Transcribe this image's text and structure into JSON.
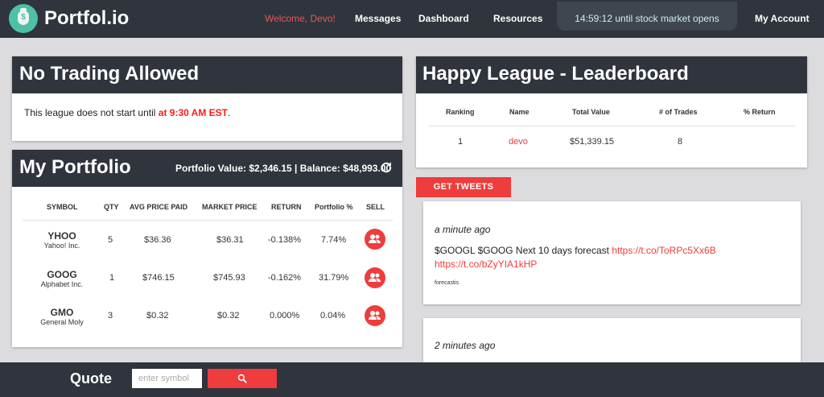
{
  "nav": {
    "brand": "Portfol.io",
    "logo_icon": "money-bag-icon",
    "welcome": "Welcome, Devo!",
    "messages": "Messages",
    "dashboard": "Dashboard",
    "resources": "Resources",
    "timer": "14:59:12 until stock market opens",
    "account": "My Account"
  },
  "notice": {
    "title": "No Trading Allowed",
    "text_prefix": "This league does not start until ",
    "time": "at 9:30 AM EST",
    "text_suffix": "."
  },
  "portfolio": {
    "title": "My Portfolio",
    "summary": "Portfolio Value: $2,346.15 | Balance: $48,993.00",
    "refresh_icon": "refresh-icon",
    "columns": [
      "SYMBOL",
      "QTY",
      "AVG PRICE PAID",
      "MARKET PRICE",
      "RETURN",
      "Portfolio %",
      "SELL"
    ],
    "rows": [
      {
        "symbol": "YHOO",
        "name": "Yahoo! Inc.",
        "qty": "5",
        "avg_price": "$36.36",
        "market_price": "$36.31",
        "return": "-0.138%",
        "portfolio_pct": "7.74%"
      },
      {
        "symbol": "GOOG",
        "name": "Alphabet Inc.",
        "qty": "1",
        "avg_price": "$746.15",
        "market_price": "$745.93",
        "return": "-0.162%",
        "portfolio_pct": "31.79%"
      },
      {
        "symbol": "GMO",
        "name": "General Moly",
        "qty": "3",
        "avg_price": "$0.32",
        "market_price": "$0.32",
        "return": "0.000%",
        "portfolio_pct": "0.04%"
      }
    ],
    "sell_icon": "users-icon"
  },
  "leaderboard": {
    "title": "Happy League - Leaderboard",
    "columns": [
      "Ranking",
      "Name",
      "Total Value",
      "# of Trades",
      "% Return"
    ],
    "rows": [
      {
        "ranking": "1",
        "name": "devo",
        "total_value": "$51,339.15",
        "trades": "8",
        "return": ""
      }
    ]
  },
  "tweets": {
    "button": "GET TWEETS",
    "items": [
      {
        "time": "a minute ago",
        "text": "$GOOGL $GOOG Next 10 days forecast ",
        "link1": "https://t.co/ToRPc5Xx6B",
        "link2": "https://t.co/bZyYIA1kHP",
        "author": "forecastis"
      },
      {
        "time": "2 minutes ago"
      }
    ]
  },
  "quote": {
    "label": "Quote",
    "placeholder": "enter symbol",
    "search_icon": "search-icon"
  },
  "colors": {
    "navbar": "#2f343d",
    "accent": "#ef3c3c",
    "logo": "#4dc0a5",
    "background": "#dcdcdf"
  }
}
